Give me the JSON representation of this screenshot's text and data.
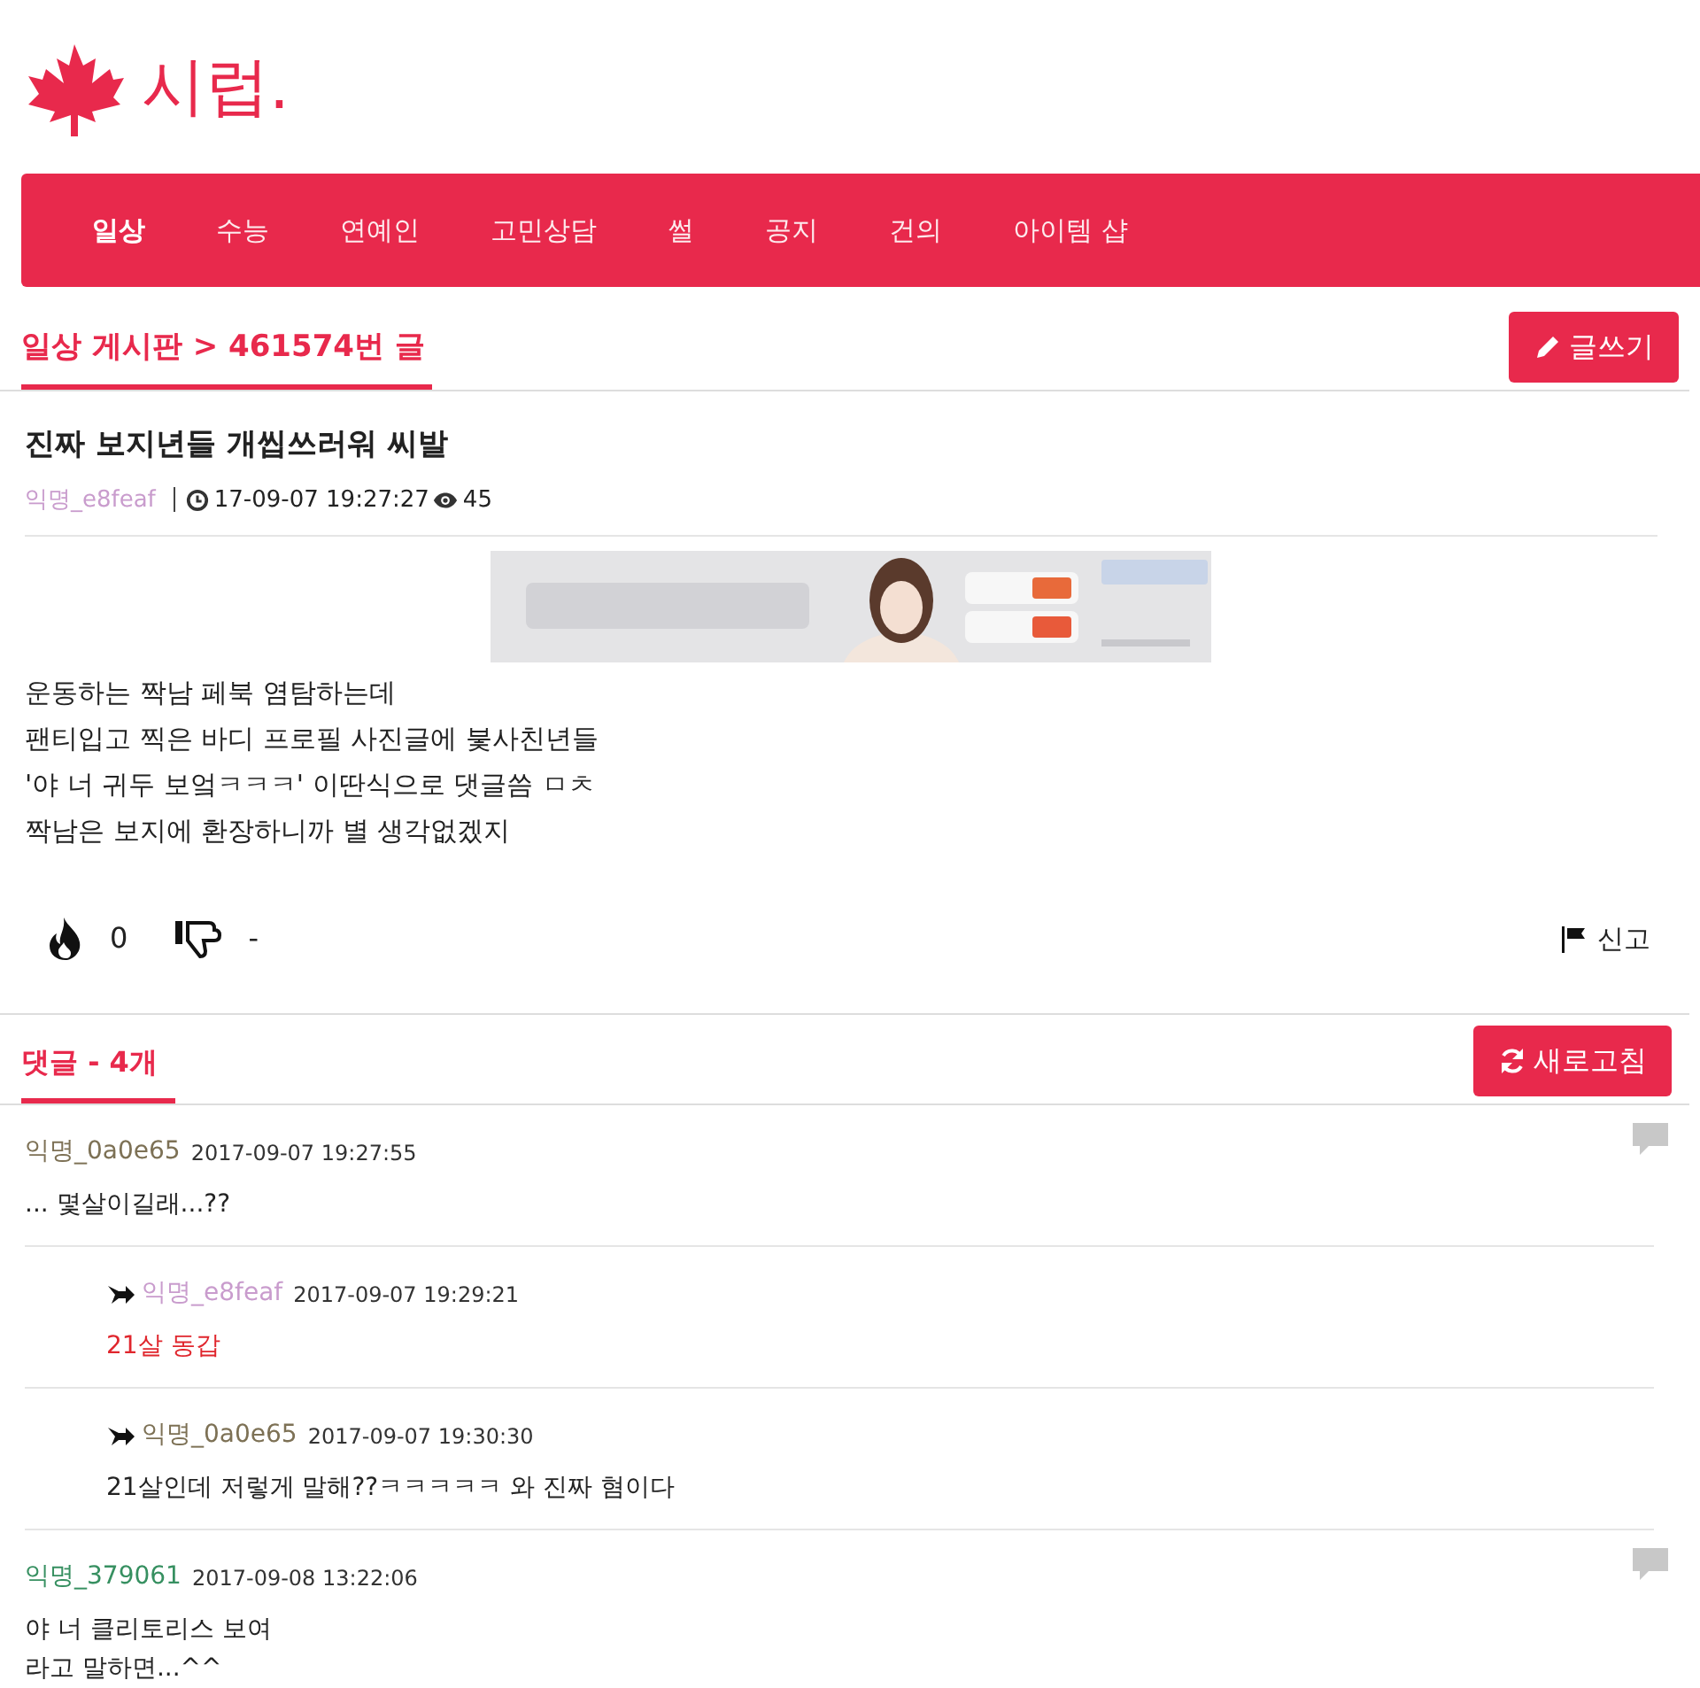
{
  "logo": {
    "text": "시럽."
  },
  "nav": [
    {
      "label": "일상",
      "selected": true
    },
    {
      "label": "수능",
      "selected": false
    },
    {
      "label": "연예인",
      "selected": false
    },
    {
      "label": "고민상담",
      "selected": false
    },
    {
      "label": "썰",
      "selected": false
    },
    {
      "label": "공지",
      "selected": false
    },
    {
      "label": "건의",
      "selected": false
    },
    {
      "label": "아이템 샵",
      "selected": false
    }
  ],
  "breadcrumb": "일상 게시판 > 461574번 글",
  "write_button": "글쓰기",
  "post": {
    "title": "진짜 보지년들 개씹쓰러워 씨발",
    "author": "익명_e8feaf",
    "color": "#c99ccd",
    "date": "17-09-07 19:27:27",
    "views": "45",
    "body": [
      "운동하는 짝남 페북 염탐하는데",
      "팬티입고 찍은 바디 프로필 사진글에 붗사친년들",
      "'야 너 귀두 보엌ㅋㅋㅋ' 이딴식으로 댓글씀 ㅁㅊ",
      "짝남은 보지에 환장하니까 별 생각없겠지"
    ],
    "likes": "0",
    "dislikes": "-",
    "report": "신고"
  },
  "comments_header": "댓글 - 4개",
  "refresh_button": "새로고침",
  "comments": [
    {
      "author": "익명_0a0e65",
      "color": "#7d7155",
      "date": "2017-09-07 19:27:55",
      "lines": [
        "... 몇살이길래...??"
      ],
      "highlight": false,
      "children": [
        {
          "author": "익명_e8feaf",
          "color": "#c99ccd",
          "date": "2017-09-07 19:29:21",
          "lines": [
            "21살 동갑"
          ],
          "highlight": true
        },
        {
          "author": "익명_0a0e65",
          "color": "#7d7155",
          "date": "2017-09-07 19:30:30",
          "lines": [
            "21살인데 저렇게 말해??ㅋㅋㅋㅋㅋ 와 진짜 혐이다"
          ],
          "highlight": false
        }
      ]
    },
    {
      "author": "익명_379061",
      "color": "#379061",
      "date": "2017-09-08 13:22:06",
      "lines": [
        "야 너 클리토리스 보여",
        "라고 말하면...^^"
      ],
      "highlight": false
    }
  ]
}
